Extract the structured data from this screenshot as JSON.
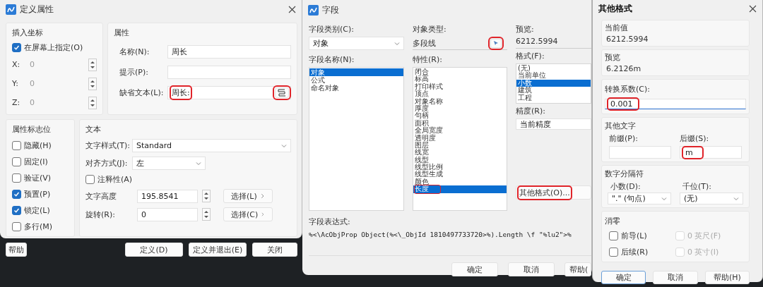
{
  "define_attribute": {
    "title": "定义属性",
    "insertion_point": {
      "heading": "插入坐标",
      "on_screen": {
        "label": "在屏幕上指定(O)",
        "checked": true
      },
      "coords": [
        {
          "label": "X:",
          "value": "0"
        },
        {
          "label": "Y:",
          "value": "0"
        },
        {
          "label": "Z:",
          "value": "0"
        }
      ]
    },
    "attribute": {
      "heading": "属性",
      "name": {
        "label": "名称(N):",
        "value": "周长"
      },
      "prompt": {
        "label": "提示(P):"
      },
      "default": {
        "label": "缺省文本(L):",
        "value": "周长:",
        "highlighted": true,
        "field_button_highlighted": true
      }
    },
    "flags": {
      "heading": "属性标志位",
      "items": [
        {
          "label": "隐藏(H)",
          "checked": false
        },
        {
          "label": "固定(I)",
          "checked": false
        },
        {
          "label": "验证(V)",
          "checked": false
        },
        {
          "label": "预置(P)",
          "checked": true
        },
        {
          "label": "锁定(L)",
          "checked": true
        },
        {
          "label": "多行(M)",
          "checked": false
        }
      ]
    },
    "text": {
      "heading": "文本",
      "style": {
        "label": "文字样式(T):",
        "value": "Standard"
      },
      "justify": {
        "label": "对齐方式(J):",
        "value": "左"
      },
      "annotative": {
        "label": "注释性(A)",
        "checked": false
      },
      "height": {
        "label": "文字高度",
        "value": "195.8541",
        "button": "选择(L)"
      },
      "rotation": {
        "label": "旋转(R):",
        "value": "0",
        "button": "选择(C)"
      }
    },
    "help": "帮助",
    "buttons": [
      "定义(D)",
      "定义并退出(E)",
      "关闭"
    ]
  },
  "field": {
    "title": "字段",
    "category": {
      "label": "字段类别(C):",
      "value": "对象"
    },
    "names": {
      "label": "字段名称(N):",
      "items": [
        {
          "label": "对象",
          "selected": true
        },
        {
          "label": "公式",
          "selected": false
        },
        {
          "label": "命名对象",
          "selected": false
        }
      ]
    },
    "object_type": {
      "label": "对象类型:",
      "value": "多段线",
      "pick_highlighted": true
    },
    "properties": {
      "label": "特性(R):",
      "items": [
        {
          "label": "闭合",
          "selected": false,
          "highlighted": false
        },
        {
          "label": "标高",
          "selected": false,
          "highlighted": false
        },
        {
          "label": "打印样式",
          "selected": false,
          "highlighted": false
        },
        {
          "label": "顶点",
          "selected": false,
          "highlighted": false
        },
        {
          "label": "对象名称",
          "selected": false,
          "highlighted": false
        },
        {
          "label": "厚度",
          "selected": false,
          "highlighted": false
        },
        {
          "label": "句柄",
          "selected": false,
          "highlighted": false
        },
        {
          "label": "面积",
          "selected": false,
          "highlighted": false
        },
        {
          "label": "全局宽度",
          "selected": false,
          "highlighted": false
        },
        {
          "label": "透明度",
          "selected": false,
          "highlighted": false
        },
        {
          "label": "图层",
          "selected": false,
          "highlighted": false
        },
        {
          "label": "线宽",
          "selected": false,
          "highlighted": false
        },
        {
          "label": "线型",
          "selected": false,
          "highlighted": false
        },
        {
          "label": "线型比例",
          "selected": false,
          "highlighted": false
        },
        {
          "label": "线型生成",
          "selected": false,
          "highlighted": false
        },
        {
          "label": "颜色",
          "selected": false,
          "highlighted": false
        },
        {
          "label": "长度",
          "selected": true,
          "highlighted": true
        }
      ]
    },
    "preview": {
      "label": "预览:",
      "value": "6212.5994"
    },
    "format": {
      "label": "格式(F):",
      "items": [
        {
          "label": "(无)",
          "selected": false
        },
        {
          "label": "当前单位",
          "selected": false
        },
        {
          "label": "小数",
          "selected": true
        },
        {
          "label": "建筑",
          "selected": false
        },
        {
          "label": "工程",
          "selected": false
        }
      ]
    },
    "precision": {
      "label": "精度(R):",
      "value": "当前精度"
    },
    "other_format": {
      "label": "其他格式(O)...",
      "highlighted": true
    },
    "expression": {
      "label": "字段表达式:",
      "value": "%<\\AcObjProp Object(%<\\_ObjId 1810497733720>%).Length \\f \"%lu2\">%"
    },
    "buttons": [
      "确定",
      "取消",
      "帮助("
    ]
  },
  "other_format": {
    "title": "其他格式",
    "current_value": {
      "heading": "当前值",
      "value": "6212.5994"
    },
    "preview": {
      "heading": "预览",
      "value": "6.2126m"
    },
    "conversion": {
      "label": "转换系数(C):",
      "value": "0.001",
      "highlighted": true
    },
    "additional_text": {
      "heading": "其他文字",
      "prefix": {
        "label": "前缀(P):"
      },
      "suffix": {
        "label": "后缀(S):",
        "value": "m",
        "highlighted": true
      }
    },
    "separators": {
      "heading": "数字分隔符",
      "decimal": {
        "label": "小数(D):",
        "value": "\".\" (句点)"
      },
      "thousands": {
        "label": "千位(T):",
        "value": "(无)"
      }
    },
    "zero_suppression": {
      "heading": "消零",
      "items": [
        {
          "label": "前导(L)",
          "checked": false,
          "disabled": false
        },
        {
          "label": "0 英尺(F)",
          "checked": false,
          "disabled": true
        },
        {
          "label": "后续(R)",
          "checked": false,
          "disabled": false
        },
        {
          "label": "0 英寸(I)",
          "checked": false,
          "disabled": true
        }
      ]
    },
    "buttons": [
      {
        "label": "确定",
        "default": true
      },
      {
        "label": "取消",
        "default": false
      },
      {
        "label": "帮助(H)",
        "default": false
      }
    ]
  }
}
